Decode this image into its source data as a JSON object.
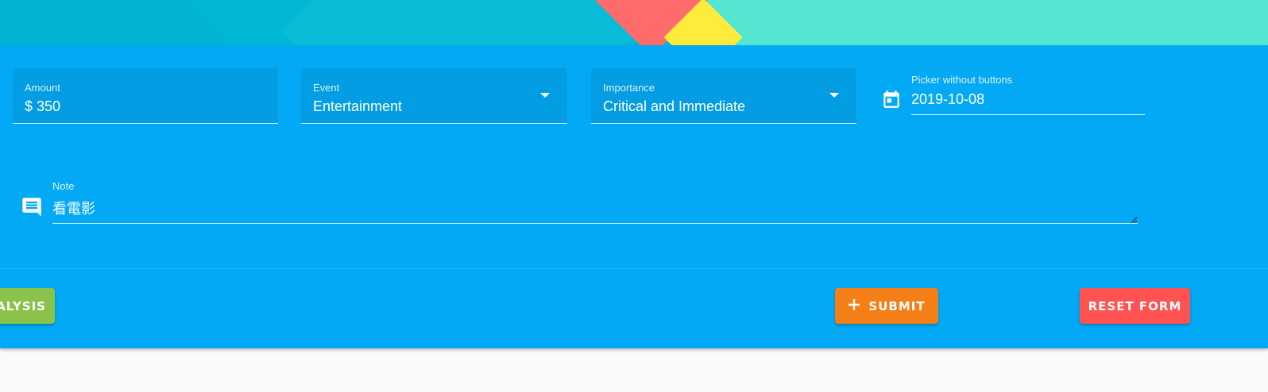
{
  "form": {
    "amount": {
      "label": "Amount",
      "value": "$ 350"
    },
    "event": {
      "label": "Event",
      "value": "Entertainment"
    },
    "importance": {
      "label": "Importance",
      "value": "Critical and Immediate"
    },
    "date": {
      "label": "Picker without buttons",
      "value": "2019-10-08",
      "icon": "calendar-icon"
    },
    "note": {
      "label": "Note",
      "value": "看電影",
      "icon": "comment-icon"
    }
  },
  "actions": {
    "analysis_label": "ALYSIS",
    "submit_label": "SUBMIT",
    "submit_icon": "plus-icon",
    "reset_label": "RESET FORM"
  },
  "colors": {
    "card": "#03a9f4",
    "submit": "#f57f17",
    "reset": "#ff5252",
    "analysis": "#8bc34a"
  }
}
